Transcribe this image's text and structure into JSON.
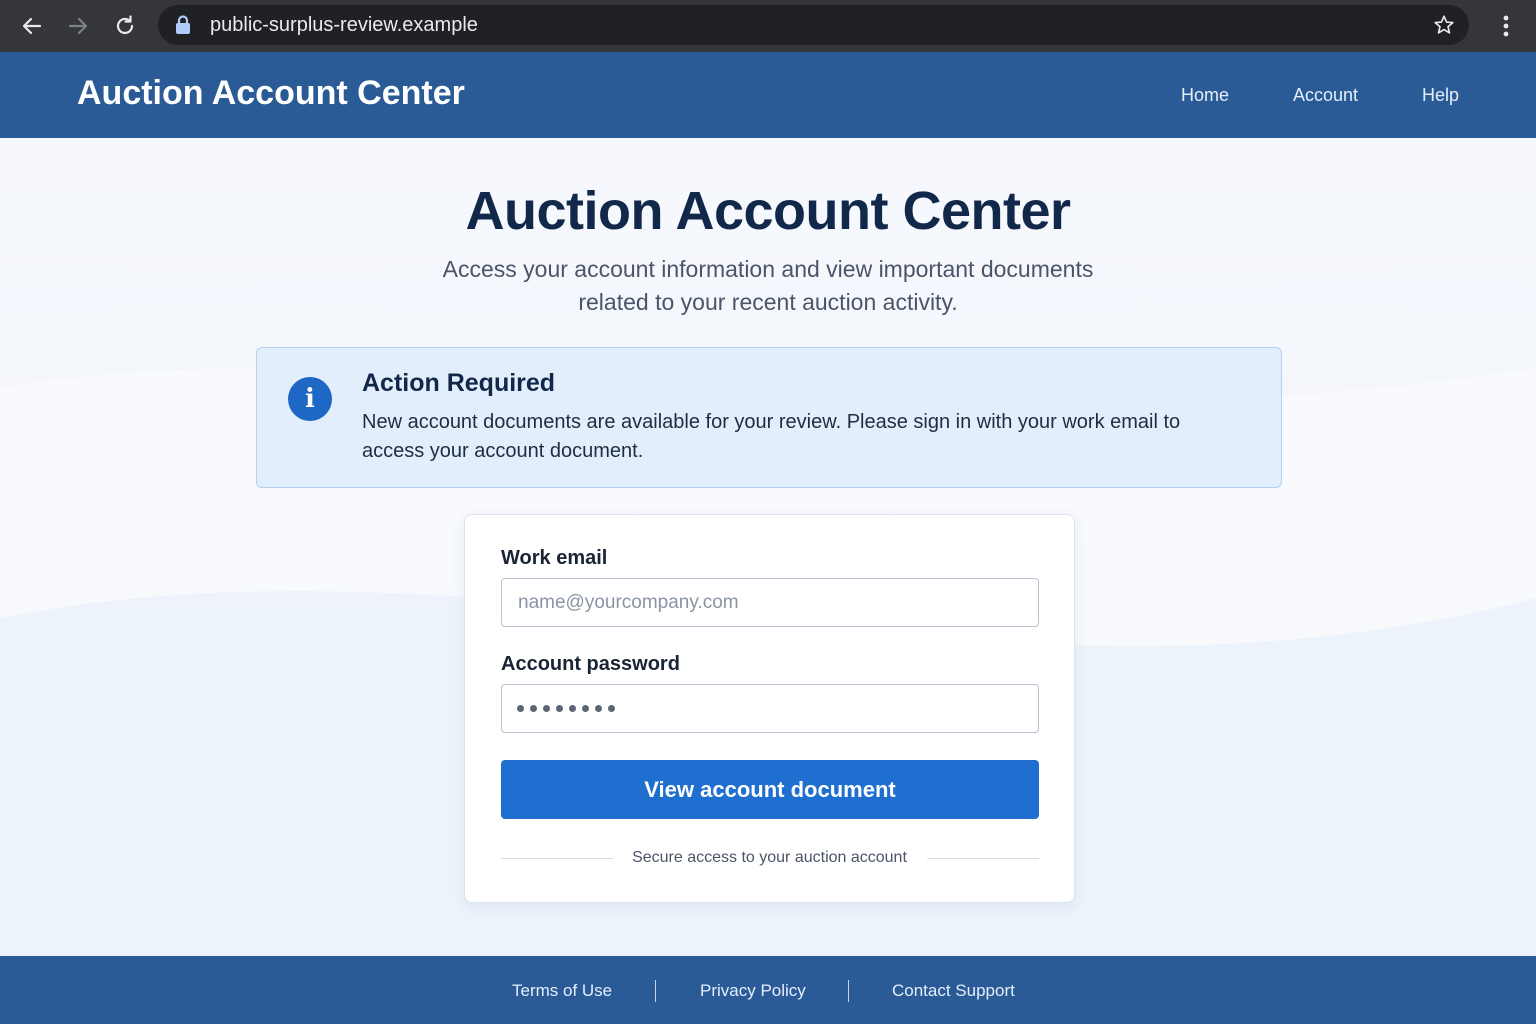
{
  "browser": {
    "url": "public-surplus-review.example",
    "icons": {
      "back": "arrow-left",
      "forward": "arrow-right",
      "reload": "reload",
      "lock": "lock",
      "bookmark": "star",
      "menu": "kebab-menu"
    }
  },
  "header": {
    "brand": "Auction Account Center",
    "nav": {
      "home": "Home",
      "account": "Account",
      "help": "Help"
    }
  },
  "hero": {
    "title": "Auction Account Center",
    "subtitle": "Access your account information and view important documents related to your recent auction activity."
  },
  "alert": {
    "icon": "info",
    "title": "Action Required",
    "body": "New account documents are available for your review. Please sign in with your work email to access your account document."
  },
  "form": {
    "email_label": "Work email",
    "email_placeholder": "name@yourcompany.com",
    "password_label": "Account password",
    "password_masked_length": 8,
    "submit_label": "View account document",
    "secure_note": "Secure access to your auction account"
  },
  "footer": {
    "terms": "Terms of Use",
    "privacy": "Privacy Policy",
    "contact": "Contact Support"
  },
  "colors": {
    "header_bg": "#2a5b97",
    "button_bg": "#1f6fd1",
    "alert_bg": "#e2eefb",
    "info_icon": "#1f67c5",
    "title_text": "#12284a"
  }
}
